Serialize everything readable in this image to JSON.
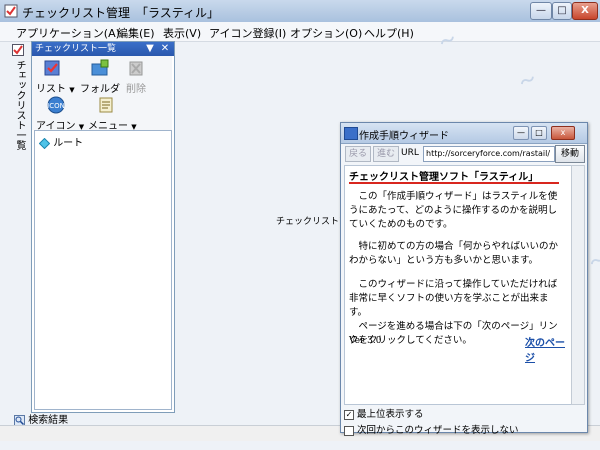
{
  "window": {
    "title": "チェックリスト管理　「ラスティル」",
    "min_glyph": "—",
    "max_glyph": "□",
    "close_glyph": "X"
  },
  "menubar": [
    "アプリケーション(A)",
    "編集(E)",
    "表示(V)",
    "アイコン登録(I)",
    "オプション(O)",
    "ヘルプ(H)"
  ],
  "left_strip": {
    "label": "チェックリスト一覧"
  },
  "panel": {
    "title": "チェックリスト一覧",
    "dropdown_glyph": "▼",
    "close_glyph": "✕",
    "toolbar": {
      "list": "リスト",
      "folder": "フォルダ",
      "delete": "削除",
      "icon": "アイコン",
      "menu": "メニュー"
    },
    "tree_root": "ルート"
  },
  "status": {
    "search_results": "検索結果"
  },
  "center_text": "チェックリストツリー",
  "wizard": {
    "title": "作成手順ウィザード",
    "nav": {
      "back": "戻る",
      "forward": "進む",
      "url_label": "URL",
      "url": "http://sorceryforce.com/rastail/",
      "go": "移動"
    },
    "heading": "チェックリスト管理ソフト「ラスティル」",
    "paragraphs": [
      "　この「作成手順ウィザード」はラスティルを使うにあたって、どのように操作するのかを説明していくためのものです。",
      "　特に初めての方の場合「何からやればいいのかわからない」という方も多いかと思います。",
      "　このウィザードに沿って操作していただければ非常に早くソフトの使い方を学ぶことが出来ます。\n　ページを進める場合は下の「次のページ」リンクをクリックしてください。"
    ],
    "version": "Ver 3.0",
    "next_link": "次のページ",
    "checkbox_topmost": {
      "label": "最上位表示する",
      "checked": true
    },
    "checkbox_hide": {
      "label": "次回からこのウィザードを表示しない",
      "checked": false
    }
  },
  "colors": {
    "accent": "#3a6fc9",
    "rule_red": "#d8261e",
    "link": "#1b4fa8"
  }
}
